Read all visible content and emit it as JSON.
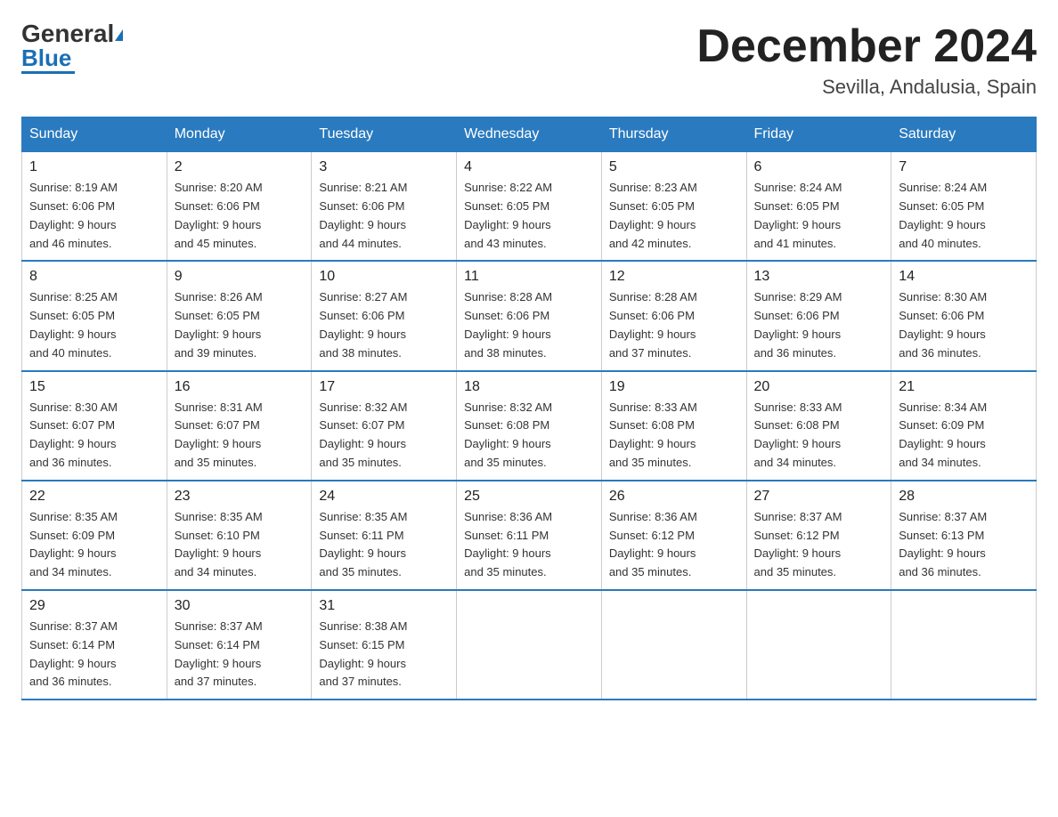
{
  "logo": {
    "text_general": "General",
    "text_blue": "Blue"
  },
  "title": "December 2024",
  "location": "Sevilla, Andalusia, Spain",
  "headers": [
    "Sunday",
    "Monday",
    "Tuesday",
    "Wednesday",
    "Thursday",
    "Friday",
    "Saturday"
  ],
  "weeks": [
    [
      {
        "day": "1",
        "sunrise": "8:19 AM",
        "sunset": "6:06 PM",
        "daylight": "9 hours and 46 minutes."
      },
      {
        "day": "2",
        "sunrise": "8:20 AM",
        "sunset": "6:06 PM",
        "daylight": "9 hours and 45 minutes."
      },
      {
        "day": "3",
        "sunrise": "8:21 AM",
        "sunset": "6:06 PM",
        "daylight": "9 hours and 44 minutes."
      },
      {
        "day": "4",
        "sunrise": "8:22 AM",
        "sunset": "6:05 PM",
        "daylight": "9 hours and 43 minutes."
      },
      {
        "day": "5",
        "sunrise": "8:23 AM",
        "sunset": "6:05 PM",
        "daylight": "9 hours and 42 minutes."
      },
      {
        "day": "6",
        "sunrise": "8:24 AM",
        "sunset": "6:05 PM",
        "daylight": "9 hours and 41 minutes."
      },
      {
        "day": "7",
        "sunrise": "8:24 AM",
        "sunset": "6:05 PM",
        "daylight": "9 hours and 40 minutes."
      }
    ],
    [
      {
        "day": "8",
        "sunrise": "8:25 AM",
        "sunset": "6:05 PM",
        "daylight": "9 hours and 40 minutes."
      },
      {
        "day": "9",
        "sunrise": "8:26 AM",
        "sunset": "6:05 PM",
        "daylight": "9 hours and 39 minutes."
      },
      {
        "day": "10",
        "sunrise": "8:27 AM",
        "sunset": "6:06 PM",
        "daylight": "9 hours and 38 minutes."
      },
      {
        "day": "11",
        "sunrise": "8:28 AM",
        "sunset": "6:06 PM",
        "daylight": "9 hours and 38 minutes."
      },
      {
        "day": "12",
        "sunrise": "8:28 AM",
        "sunset": "6:06 PM",
        "daylight": "9 hours and 37 minutes."
      },
      {
        "day": "13",
        "sunrise": "8:29 AM",
        "sunset": "6:06 PM",
        "daylight": "9 hours and 36 minutes."
      },
      {
        "day": "14",
        "sunrise": "8:30 AM",
        "sunset": "6:06 PM",
        "daylight": "9 hours and 36 minutes."
      }
    ],
    [
      {
        "day": "15",
        "sunrise": "8:30 AM",
        "sunset": "6:07 PM",
        "daylight": "9 hours and 36 minutes."
      },
      {
        "day": "16",
        "sunrise": "8:31 AM",
        "sunset": "6:07 PM",
        "daylight": "9 hours and 35 minutes."
      },
      {
        "day": "17",
        "sunrise": "8:32 AM",
        "sunset": "6:07 PM",
        "daylight": "9 hours and 35 minutes."
      },
      {
        "day": "18",
        "sunrise": "8:32 AM",
        "sunset": "6:08 PM",
        "daylight": "9 hours and 35 minutes."
      },
      {
        "day": "19",
        "sunrise": "8:33 AM",
        "sunset": "6:08 PM",
        "daylight": "9 hours and 35 minutes."
      },
      {
        "day": "20",
        "sunrise": "8:33 AM",
        "sunset": "6:08 PM",
        "daylight": "9 hours and 34 minutes."
      },
      {
        "day": "21",
        "sunrise": "8:34 AM",
        "sunset": "6:09 PM",
        "daylight": "9 hours and 34 minutes."
      }
    ],
    [
      {
        "day": "22",
        "sunrise": "8:35 AM",
        "sunset": "6:09 PM",
        "daylight": "9 hours and 34 minutes."
      },
      {
        "day": "23",
        "sunrise": "8:35 AM",
        "sunset": "6:10 PM",
        "daylight": "9 hours and 34 minutes."
      },
      {
        "day": "24",
        "sunrise": "8:35 AM",
        "sunset": "6:11 PM",
        "daylight": "9 hours and 35 minutes."
      },
      {
        "day": "25",
        "sunrise": "8:36 AM",
        "sunset": "6:11 PM",
        "daylight": "9 hours and 35 minutes."
      },
      {
        "day": "26",
        "sunrise": "8:36 AM",
        "sunset": "6:12 PM",
        "daylight": "9 hours and 35 minutes."
      },
      {
        "day": "27",
        "sunrise": "8:37 AM",
        "sunset": "6:12 PM",
        "daylight": "9 hours and 35 minutes."
      },
      {
        "day": "28",
        "sunrise": "8:37 AM",
        "sunset": "6:13 PM",
        "daylight": "9 hours and 36 minutes."
      }
    ],
    [
      {
        "day": "29",
        "sunrise": "8:37 AM",
        "sunset": "6:14 PM",
        "daylight": "9 hours and 36 minutes."
      },
      {
        "day": "30",
        "sunrise": "8:37 AM",
        "sunset": "6:14 PM",
        "daylight": "9 hours and 37 minutes."
      },
      {
        "day": "31",
        "sunrise": "8:38 AM",
        "sunset": "6:15 PM",
        "daylight": "9 hours and 37 minutes."
      },
      null,
      null,
      null,
      null
    ]
  ],
  "labels": {
    "sunrise": "Sunrise:",
    "sunset": "Sunset:",
    "daylight": "Daylight:"
  }
}
